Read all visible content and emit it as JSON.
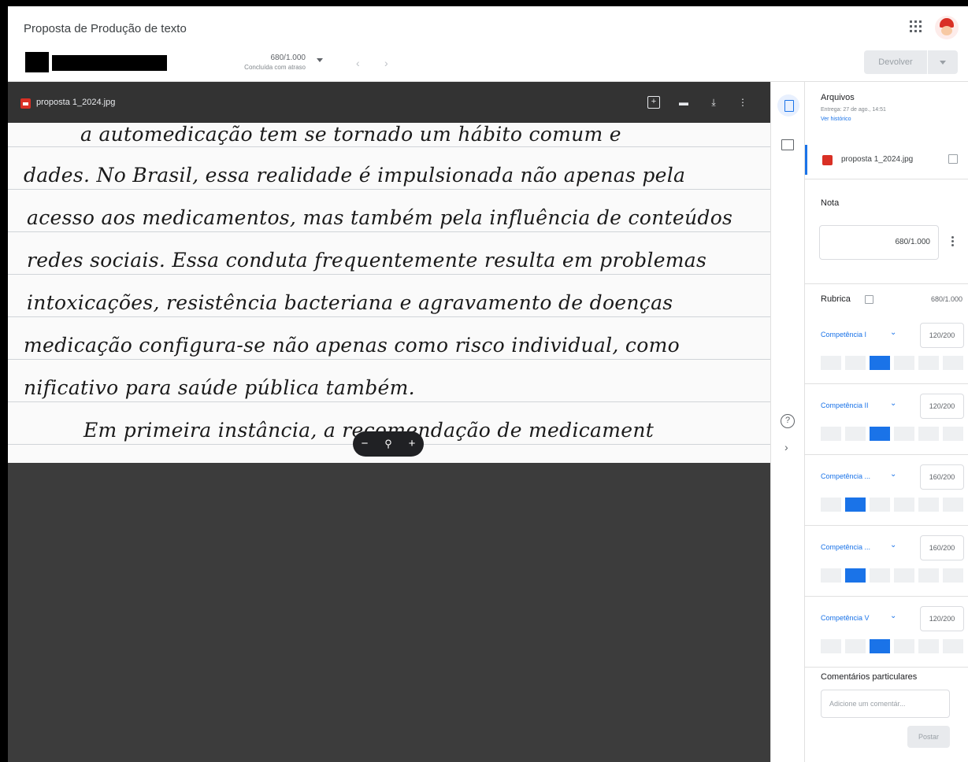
{
  "header": {
    "title": "Proposta de Produção de texto",
    "student_grade": "680/1.000",
    "student_status": "Concluída com atraso",
    "return_label": "Devolver"
  },
  "viewer": {
    "file_name": "proposta 1_2024.jpg",
    "handwriting": [
      "a automedicação tem se tornado um hábito comum e",
      "dades. No Brasil, essa realidade é impulsionada não apenas pela",
      "acesso aos medicamentos, mas também pela influência de conteúdos",
      "redes sociais. Essa conduta frequentemente resulta em problemas",
      "intoxicações, resistência bacteriana e agravamento de doenças",
      "medicação configura-se não apenas como risco individual, como",
      "nificativo para saúde pública também.",
      "Em primeira instância, a recomendação de medicament"
    ]
  },
  "panel": {
    "files_title": "Arquivos",
    "files_delivered": "Entrega: 27 de ago., 14:51",
    "files_history_link": "Ver histórico",
    "attachment_name": "proposta 1_2024.jpg",
    "grade_title": "Nota",
    "grade_value": "680/1.000",
    "rubric_title": "Rubrica",
    "rubric_total": "680/1.000",
    "criteria": [
      {
        "name": "Competência I",
        "score": "120/200",
        "levels": 6,
        "selected": 2
      },
      {
        "name": "Competência II",
        "score": "120/200",
        "levels": 6,
        "selected": 2
      },
      {
        "name": "Competência ...",
        "score": "160/200",
        "levels": 6,
        "selected": 1
      },
      {
        "name": "Competência ...",
        "score": "160/200",
        "levels": 6,
        "selected": 1
      },
      {
        "name": "Competência V",
        "score": "120/200",
        "levels": 6,
        "selected": 2
      }
    ],
    "comments_title": "Comentários particulares",
    "comments_placeholder": "Adicione um comentár...",
    "post_label": "Postar"
  }
}
